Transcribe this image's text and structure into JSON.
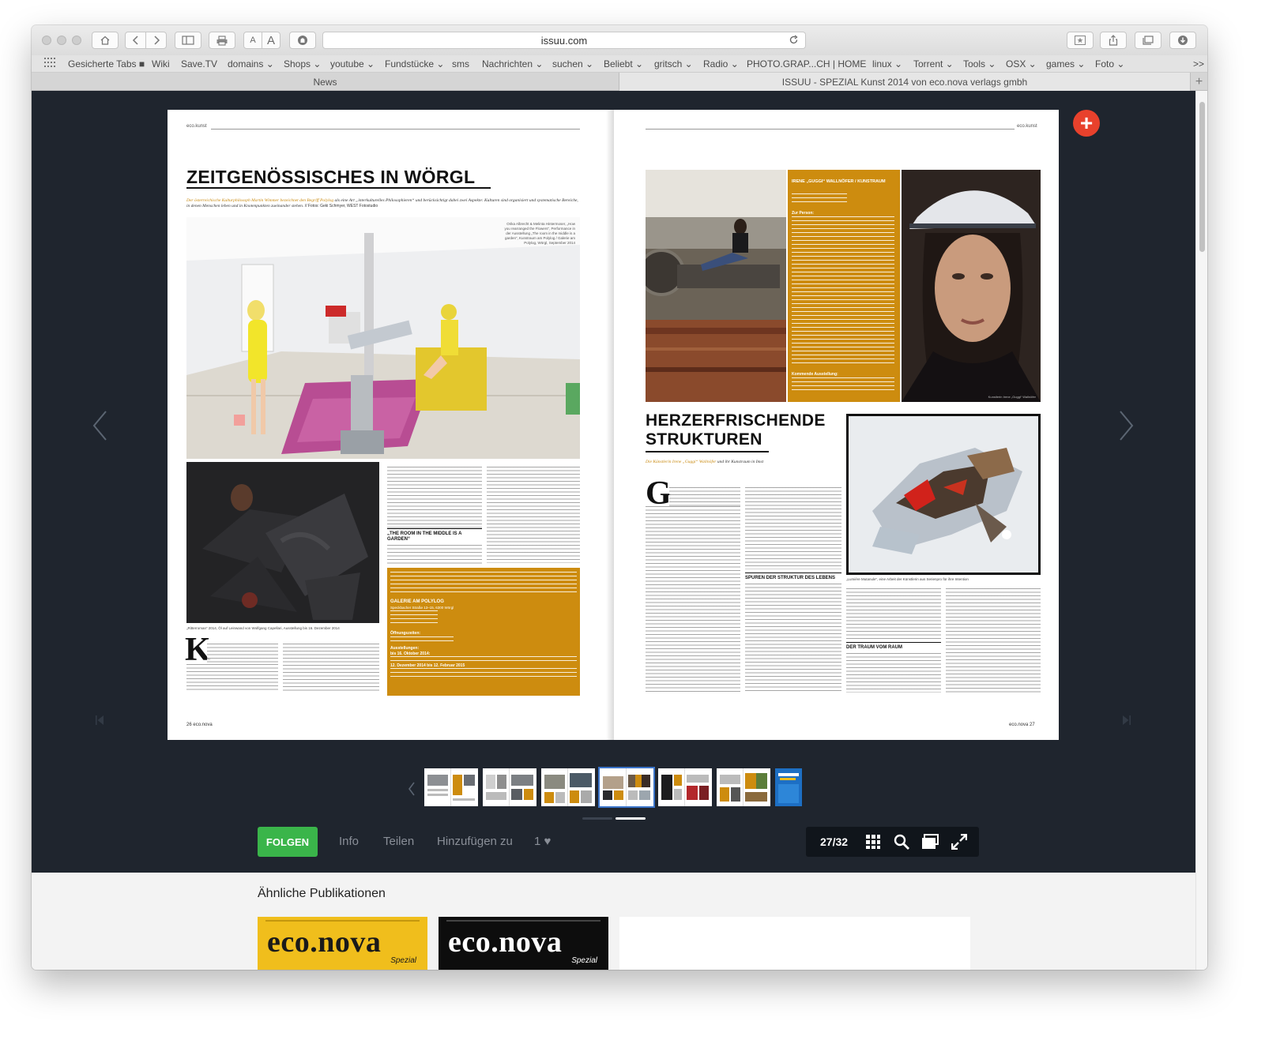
{
  "browser": {
    "url": "issuu.com",
    "bookmarks": [
      {
        "label": "Gesicherte Tabs ■"
      },
      {
        "label": "Wiki"
      },
      {
        "label": "Save.TV"
      },
      {
        "label": "domains ⌄"
      },
      {
        "label": "Shops ⌄"
      },
      {
        "label": "youtube ⌄"
      },
      {
        "label": "Fundstücke ⌄"
      },
      {
        "label": "sms"
      },
      {
        "label": "Nachrichten ⌄"
      },
      {
        "label": "suchen ⌄"
      },
      {
        "label": "Beliebt ⌄"
      },
      {
        "label": "gritsch ⌄"
      },
      {
        "label": "Radio ⌄"
      },
      {
        "label": "PHOTO.GRAP...CH | HOME"
      },
      {
        "label": "linux ⌄"
      },
      {
        "label": "Torrent ⌄"
      },
      {
        "label": "Tools ⌄"
      },
      {
        "label": "OSX ⌄"
      },
      {
        "label": "games ⌄"
      },
      {
        "label": "Foto ⌄"
      }
    ],
    "overflow": ">>",
    "tabs": [
      {
        "label": "News"
      },
      {
        "label": "ISSUU - SPEZIAL Kunst 2014 von eco.nova verlags gmbh"
      }
    ],
    "new_tab": "+"
  },
  "left_page": {
    "runhead": "eco.kunst",
    "headline": "ZEITGENÖSSISCHES IN WÖRGL",
    "deck_orange": "Der österreichische Kulturphilosoph Martin Wimmer bezeichnet den Begriff Polylog",
    "deck_rest": "als eine Art „interkulturelles Philosophieren“ und berücksichtigt dabei zwei Aspekte: Kulturen sind organisiert und systematische Bereiche, in denen Menschen leben und in Knotenpunkten zueinander stehen.",
    "deck_credit": "// Fotos: Geki Schmyer, WEST Fotostudio",
    "photo_caption": "Orika Albrecht & Melinta Hintermoser, „How you rearranged the Flowers“, Performance in der Ausstellung „The room in the middle is a garden“, Kunstraum am Polylog / Galerie am Polylog, Wörgl, September 2014",
    "small_caption": "„Ritterroman“ 2014, Öl auf Leinwand von Wolfgang Capellari, Ausstellung bis 16. Dezember 2014",
    "dropcap": "K",
    "subhead": "„THE ROOM IN THE MIDDLE IS A GARDEN“",
    "infobox_title": "GALERIE AM POLYLOG",
    "infobox_address": "Speckbacher Straße 13–15, 6300 Wörgl",
    "infobox_hours_title": "Öffnungszeiten:",
    "infobox_exh_title": "Ausstellungen:",
    "infobox_exh1": "bis 16. Oktober 2014:",
    "infobox_exh2": "12. Dezember 2014 bis 12. Februar 2015",
    "folio": "26",
    "foot_brand": "eco.nova"
  },
  "right_page": {
    "runhead": "eco.kunst",
    "infobox_title": "IRENE „GUGGI“ WALLNÖFER / KUNSTRAUM",
    "infobox_sub": "Zur Person:",
    "infobox_sub2": "Kommende Ausstellung:",
    "headline_line1": "HERZERFRISCHENDE",
    "headline_line2": "STRUKTUREN",
    "deck_orange": "Die Künstlerin Irene „Guggi“ Wallnöfer",
    "deck_rest": "und ihr Kunstraum in Imst",
    "dropcap": "G",
    "painting_caption": "„Lumière Mutanule“, eine Arbeit der Künstlerin aus Serienpro für ihre Intention",
    "subhead1": "SPUREN DER STRUKTUR DES LEBENS",
    "subhead2": "DER TRAUM VOM RAUM",
    "portrait_caption": "Kunstlerin Irene „Guggi“ Wallnöfer",
    "folio": "27",
    "foot_brand": "eco.nova"
  },
  "reader": {
    "follow_label": "FOLGEN",
    "info_label": "Info",
    "share_label": "Teilen",
    "add_label": "Hinzufügen zu",
    "likes_label": "1 ♥",
    "page_count": "27/32",
    "plus_label": "+"
  },
  "similar": {
    "heading": "Ähnliche Publikationen",
    "items": [
      {
        "title": "eco.nova",
        "subtitle": "Spezial"
      },
      {
        "title": "eco.nova",
        "subtitle": "Spezial"
      }
    ]
  },
  "colors": {
    "reader_bg": "#1f252e",
    "accent_orange": "#cd8c0f",
    "follow_green": "#3ab54a",
    "plus_red": "#e8412c",
    "pub_yellow": "#f0be1c"
  }
}
